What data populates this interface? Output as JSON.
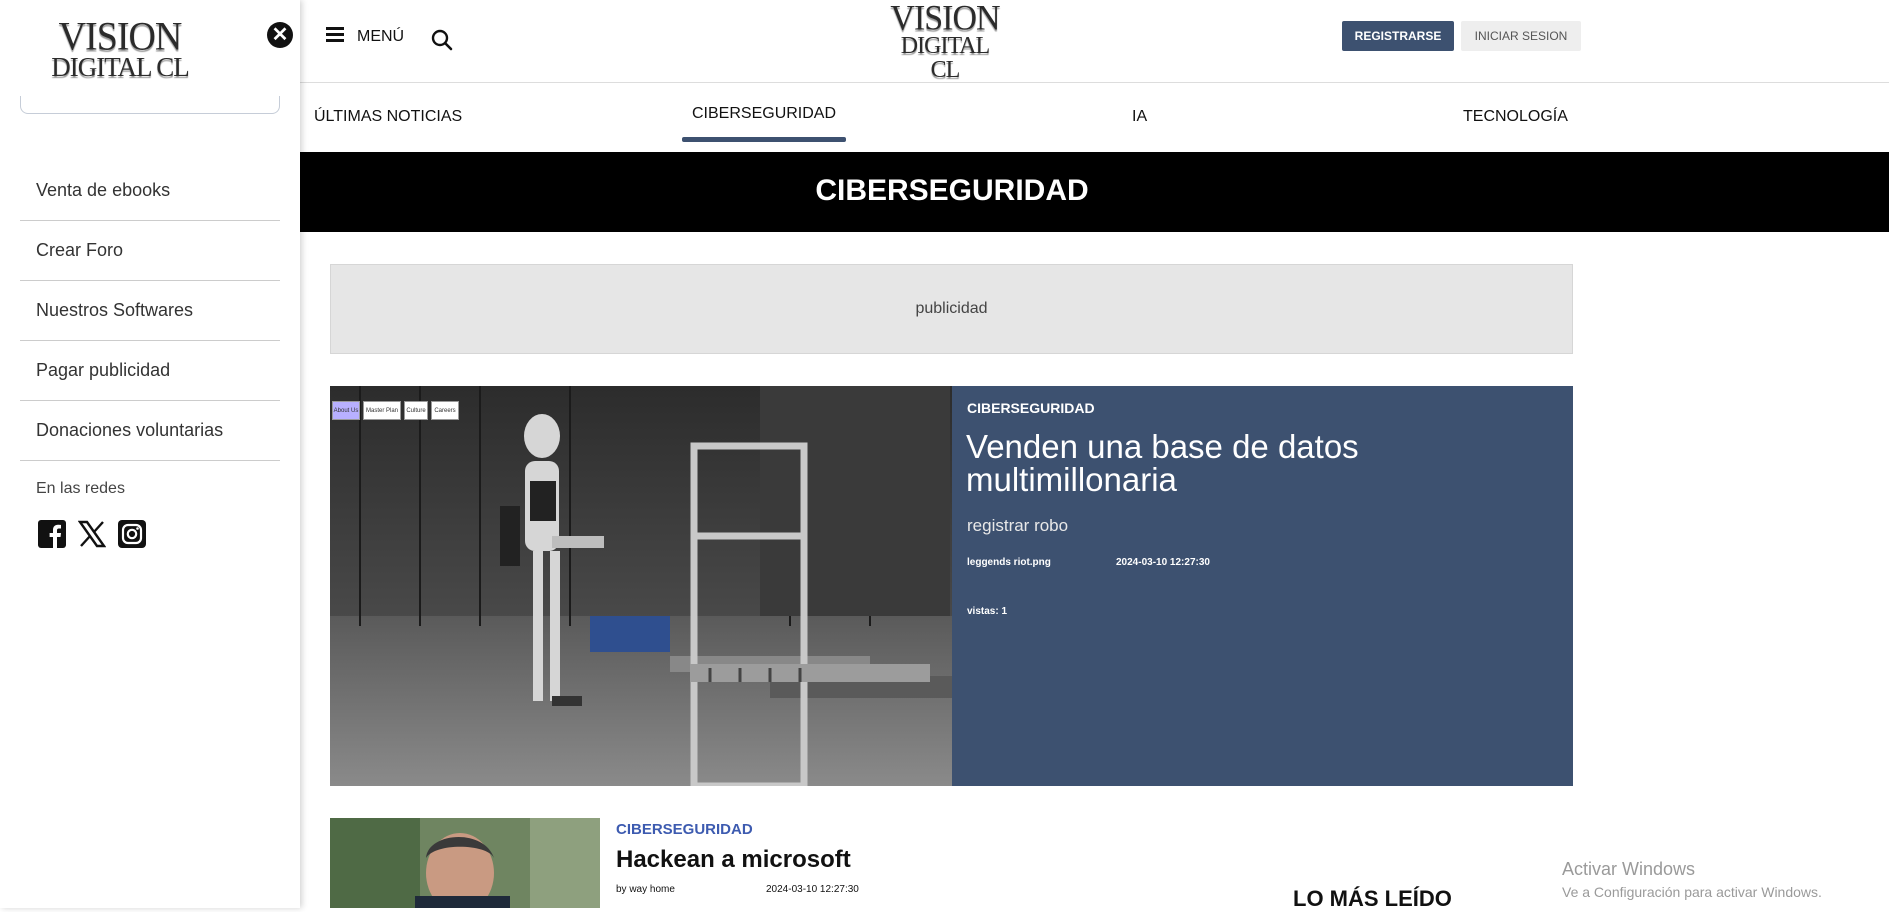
{
  "brand": {
    "line1": "VISION",
    "line2": "DIGITAL CL"
  },
  "sidebar": {
    "close_icon": "close-icon",
    "items": [
      {
        "label": "Venta de ebooks"
      },
      {
        "label": "Crear Foro"
      },
      {
        "label": "Nuestros Softwares"
      },
      {
        "label": "Pagar publicidad"
      },
      {
        "label": "Donaciones voluntarias"
      }
    ],
    "social_heading": "En las redes",
    "social_icons": [
      "facebook-icon",
      "x-icon",
      "instagram-icon"
    ]
  },
  "header": {
    "menu_label": "MENÚ",
    "menu_icon": "hamburger-icon",
    "search_icon": "search-icon",
    "register_label": "REGISTRARSE",
    "login_label": "INICIAR SESION",
    "accent_color": "#3d5170"
  },
  "nav": {
    "tabs": [
      {
        "label": "ÚLTIMAS NOTICIAS",
        "active": false
      },
      {
        "label": "CIBERSEGURIDAD",
        "active": true
      },
      {
        "label": "IA",
        "active": false
      },
      {
        "label": "TECNOLOGÍA",
        "active": false
      }
    ]
  },
  "banner": {
    "title": "CIBERSEGURIDAD"
  },
  "ad": {
    "label": "publicidad"
  },
  "featured": {
    "image_tags": [
      "About Us",
      "Master Plan",
      "Culture",
      "Careers"
    ],
    "category": "CIBERSEGURIDAD",
    "title": "Venden una base de datos multimillonaria",
    "subtitle": "registrar robo",
    "author": "leggends riot.png",
    "date": "2024-03-10 12:27:30",
    "views": "vistas: 1"
  },
  "article2": {
    "category": "CIBERSEGURIDAD",
    "title": "Hackean a microsoft",
    "author": "by way home",
    "date": "2024-03-10 12:27:30"
  },
  "most_read": {
    "heading": "LO MÁS LEÍDO"
  },
  "watermark": {
    "line1": "Activar Windows",
    "line2": "Ve a Configuración para activar Windows."
  }
}
